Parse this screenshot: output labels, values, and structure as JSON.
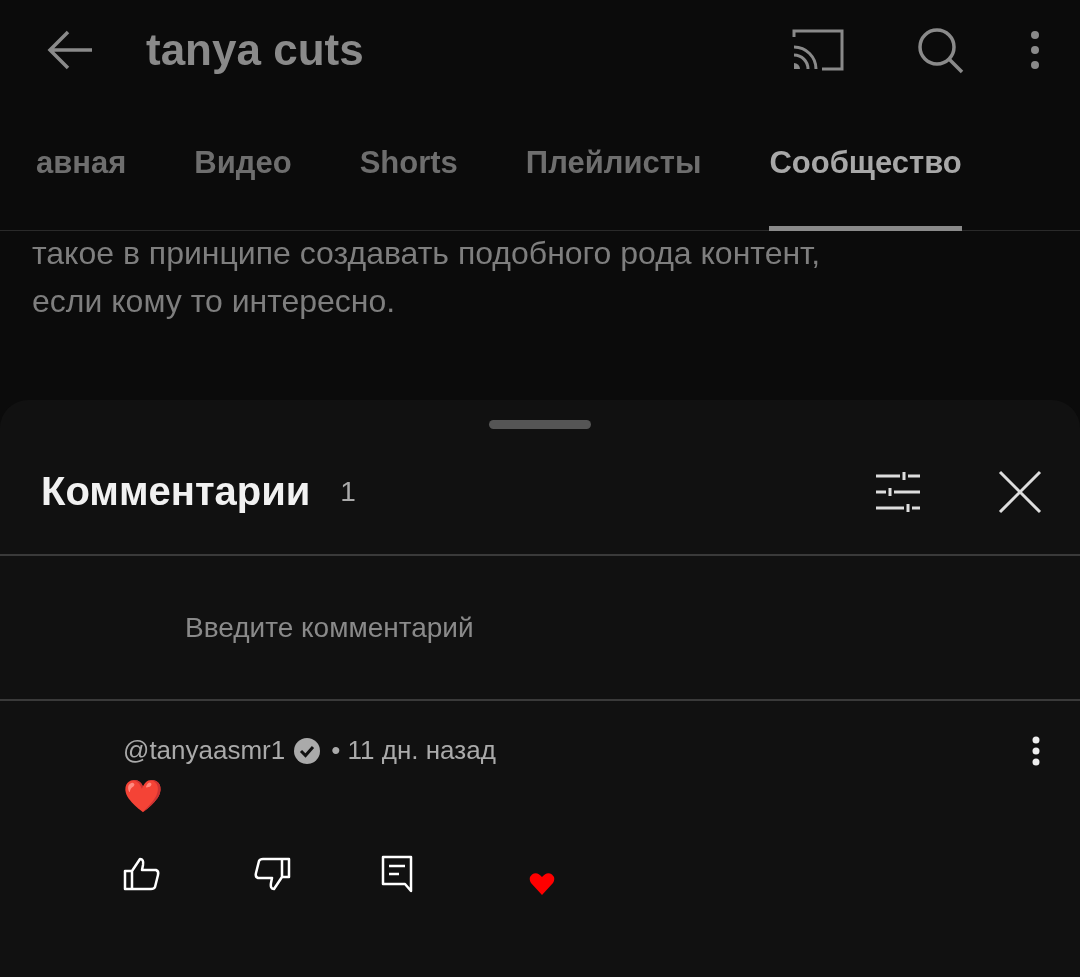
{
  "header": {
    "title": "tanya cuts"
  },
  "tabs": [
    {
      "label": "авная",
      "selected": false
    },
    {
      "label": "Видео",
      "selected": false
    },
    {
      "label": "Shorts",
      "selected": false
    },
    {
      "label": "Плейлисты",
      "selected": false
    },
    {
      "label": "Сообщество",
      "selected": true
    }
  ],
  "post": {
    "lines": [
      "такое в принципе создавать подобного рода контент,",
      "если кому то интересно."
    ]
  },
  "comments_sheet": {
    "title": "Комментарии",
    "count": "1",
    "input": {
      "placeholder": "Введите комментарий"
    },
    "comments": [
      {
        "author": "@tanyaasmr1",
        "verified": true,
        "time": "• 11 дн. назад",
        "text": "❤️",
        "creator_heart": true
      }
    ]
  }
}
